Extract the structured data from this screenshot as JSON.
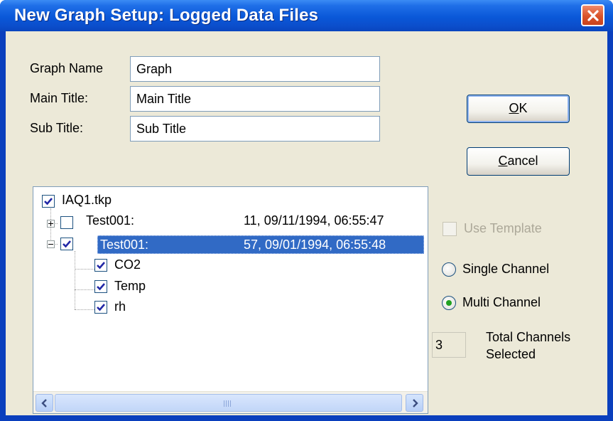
{
  "window": {
    "title": "New Graph Setup: Logged Data Files",
    "close_icon": "close-x-icon"
  },
  "form": {
    "graph_name": {
      "label": "Graph Name",
      "value": "Graph"
    },
    "main_title": {
      "label": "Main Title:",
      "value": "Main Title"
    },
    "sub_title": {
      "label": "Sub Title:",
      "value": "Sub Title"
    }
  },
  "buttons": {
    "ok": {
      "accel": "O",
      "rest": "K"
    },
    "cancel": {
      "accel": "C",
      "rest": "ancel"
    }
  },
  "tree": {
    "root": {
      "label": "IAQ1.tkp",
      "checked": true
    },
    "nodes": [
      {
        "name": "Test001:",
        "info": "11, 09/11/1994, 06:55:47",
        "checked": false,
        "expanded": false,
        "selected": false
      },
      {
        "name": "Test001:",
        "info": "57, 09/01/1994, 06:55:48",
        "checked": true,
        "expanded": true,
        "selected": true,
        "children": [
          {
            "label": "CO2",
            "checked": true
          },
          {
            "label": "Temp",
            "checked": true
          },
          {
            "label": "rh",
            "checked": true
          }
        ]
      }
    ]
  },
  "options": {
    "use_template": {
      "label": "Use Template",
      "checked": false,
      "enabled": false
    },
    "single_channel": {
      "label": "Single Channel",
      "selected": false
    },
    "multi_channel": {
      "label": "Multi Channel",
      "selected": true
    }
  },
  "channels": {
    "count": "3",
    "label_line1": "Total Channels",
    "label_line2": "Selected"
  },
  "colors": {
    "title_bar": "#0a58d8",
    "client_bg": "#ece9d8",
    "selection": "#316ac5",
    "check": "#21a121"
  }
}
